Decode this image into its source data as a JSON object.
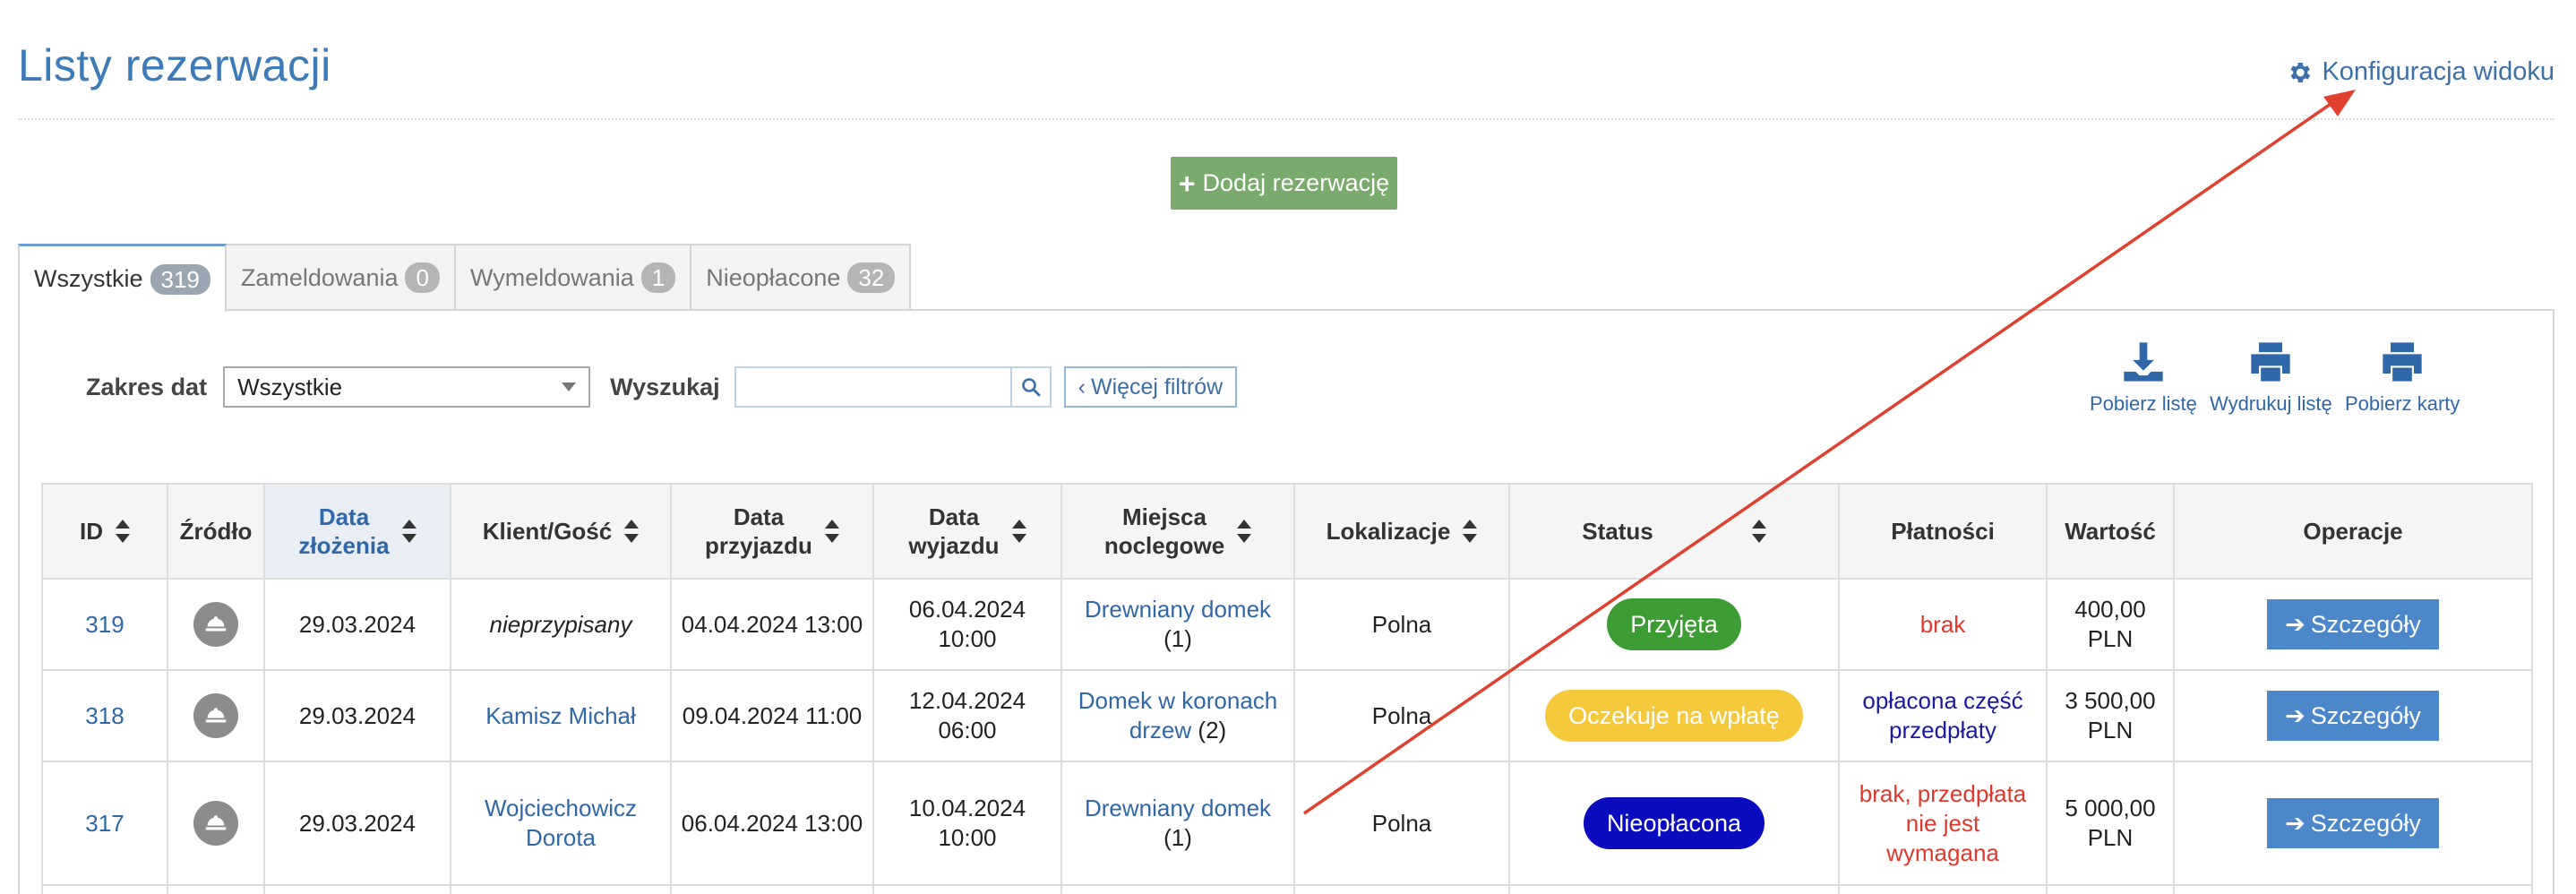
{
  "page": {
    "title": "Listy rezerwacji",
    "config_label": "Konfiguracja widoku",
    "add_label": "Dodaj rezerwację"
  },
  "tabs": [
    {
      "label": "Wszystkie",
      "count": "319"
    },
    {
      "label": "Zameldowania",
      "count": "0"
    },
    {
      "label": "Wymeldowania",
      "count": "1"
    },
    {
      "label": "Nieopłacone",
      "count": "32"
    }
  ],
  "filters": {
    "date_range_label": "Zakres dat",
    "date_range_value": "Wszystkie",
    "search_label": "Wyszukaj",
    "search_value": "",
    "more_filters_label": "Więcej filtrów"
  },
  "actions": {
    "download": "Pobierz listę",
    "print_list": "Wydrukuj listę",
    "print_cards": "Pobierz karty"
  },
  "table": {
    "headers": {
      "id": "ID",
      "source": "Źródło",
      "created_1": "Data",
      "created_2": "złożenia",
      "client": "Klient/Gość",
      "arrival_1": "Data",
      "arrival_2": "przyjazdu",
      "departure_1": "Data",
      "departure_2": "wyjazdu",
      "places_1": "Miejsca",
      "places_2": "noclegowe",
      "locations": "Lokalizacje",
      "status": "Status",
      "payments": "Płatności",
      "value": "Wartość",
      "operations": "Operacje"
    },
    "rows": [
      {
        "id": "319",
        "created": "29.03.2024",
        "client": "nieprzypisany",
        "arrival": "04.04.2024 13:00",
        "departure_1": "06.04.2024",
        "departure_2": "10:00",
        "place_1": "Drewniany domek",
        "place_2": "",
        "place_count": "(1)",
        "location": "Polna",
        "status": "Przyjęta",
        "payment_1": "brak",
        "payment_2": "",
        "payment_3": "",
        "value_1": "400,00",
        "value_2": "PLN",
        "details": "Szczegóły"
      },
      {
        "id": "318",
        "created": "29.03.2024",
        "client_1": "Kamisz Michał",
        "arrival": "09.04.2024 11:00",
        "departure_1": "12.04.2024",
        "departure_2": "06:00",
        "place_1": "Domek w koronach",
        "place_2": "drzew",
        "place_count": "(2)",
        "location": "Polna",
        "status": "Oczekuje na wpłatę",
        "payment_1": "opłacona część",
        "payment_2": "przedpłaty",
        "value_1": "3 500,00",
        "value_2": "PLN",
        "details": "Szczegóły"
      },
      {
        "id": "317",
        "created": "29.03.2024",
        "client_1": "Wojciechowicz",
        "client_2": "Dorota",
        "arrival": "06.04.2024 13:00",
        "departure_1": "10.04.2024",
        "departure_2": "10:00",
        "place_1": "Drewniany domek",
        "place_count": "(1)",
        "location": "Polna",
        "status": "Nieopłacona",
        "payment_1": "brak, przedpłata",
        "payment_2": "nie jest",
        "payment_3": "wymagana",
        "value_1": "5 000,00",
        "value_2": "PLN",
        "details": "Szczegóły"
      }
    ]
  },
  "colors": {
    "accent": "#3d7ab8",
    "status_accepted": "#3e9c34",
    "status_waiting": "#f4c93c",
    "status_unpaid": "#0b0bbf",
    "annotation_arrow": "#e0412f"
  }
}
